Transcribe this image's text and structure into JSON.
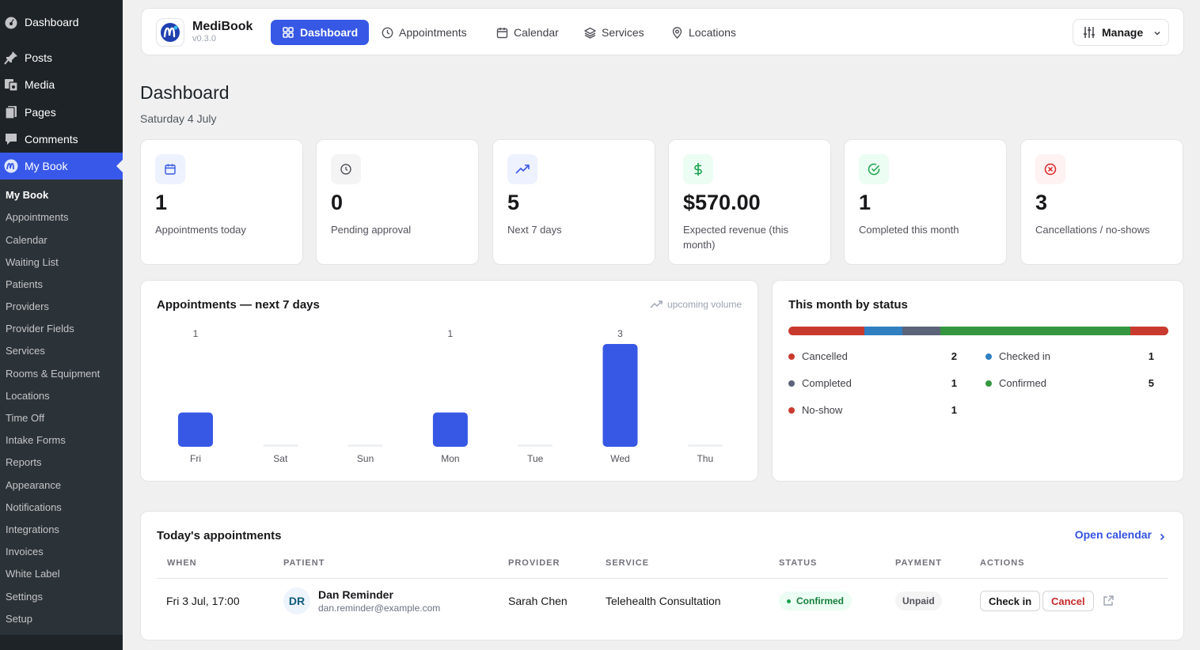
{
  "wp_menu": {
    "top_items": [
      {
        "label": "Dashboard",
        "icon": "dashboard-icon"
      },
      {
        "label": "Posts",
        "icon": "pin-icon"
      },
      {
        "label": "Media",
        "icon": "media-icon"
      },
      {
        "label": "Pages",
        "icon": "pages-icon"
      },
      {
        "label": "Comments",
        "icon": "comment-icon"
      },
      {
        "label": "My Book",
        "icon": "medibook-logo-icon"
      }
    ],
    "submenu": [
      "My Book",
      "Appointments",
      "Calendar",
      "Waiting List",
      "Patients",
      "Providers",
      "Provider Fields",
      "Services",
      "Rooms & Equipment",
      "Locations",
      "Time Off",
      "Intake Forms",
      "Reports",
      "Appearance",
      "Notifications",
      "Integrations",
      "Invoices",
      "White Label",
      "Settings",
      "Setup"
    ]
  },
  "brand": {
    "name": "MediBook",
    "version": "v0.3.0"
  },
  "nav": {
    "tabs": [
      {
        "label": "Dashboard",
        "icon": "grid-icon"
      },
      {
        "label": "Appointments",
        "icon": "clock-icon"
      },
      {
        "label": "Calendar",
        "icon": "calendar-icon"
      },
      {
        "label": "Services",
        "icon": "layers-icon"
      },
      {
        "label": "Locations",
        "icon": "map-pin-icon"
      }
    ],
    "manage_label": "Manage"
  },
  "page": {
    "title": "Dashboard",
    "date": "Saturday 4 July"
  },
  "stats": [
    {
      "value": "1",
      "label": "Appointments today",
      "icon": "calendar-icon",
      "color": "#3758e5",
      "bg": "#eef2ff"
    },
    {
      "value": "0",
      "label": "Pending approval",
      "icon": "clock-icon",
      "color": "#52525b",
      "bg": "#f4f4f5"
    },
    {
      "value": "5",
      "label": "Next 7 days",
      "icon": "trending-up-icon",
      "color": "#3758e5",
      "bg": "#eef2ff"
    },
    {
      "value": "$570.00",
      "label": "Expected revenue (this month)",
      "icon": "dollar-icon",
      "color": "#16a34a",
      "bg": "#ecfdf3"
    },
    {
      "value": "1",
      "label": "Completed this month",
      "icon": "check-circle-icon",
      "color": "#16a34a",
      "bg": "#ecfdf3"
    },
    {
      "value": "3",
      "label": "Cancellations / no-shows",
      "icon": "x-circle-icon",
      "color": "#dc2626",
      "bg": "#fef2f2"
    }
  ],
  "chart_data": {
    "type": "bar",
    "title": "Appointments — next 7 days",
    "subtitle": "upcoming volume",
    "categories": [
      "Fri",
      "Sat",
      "Sun",
      "Mon",
      "Tue",
      "Wed",
      "Thu"
    ],
    "values": [
      1,
      0,
      0,
      1,
      0,
      3,
      0
    ],
    "ylim": [
      0,
      3
    ],
    "bar_color": "#3758e5",
    "grid": false
  },
  "status_panel": {
    "title": "This month by status",
    "segments": [
      {
        "name": "Cancelled",
        "count": 2,
        "color": "#c93a2e"
      },
      {
        "name": "Checked in",
        "count": 1,
        "color": "#2f7fc1"
      },
      {
        "name": "Completed",
        "count": 1,
        "color": "#5b6478"
      },
      {
        "name": "Confirmed",
        "count": 5,
        "color": "#34963f"
      },
      {
        "name": "No-show",
        "count": 1,
        "color": "#c93a2e"
      }
    ],
    "legend": [
      {
        "name": "Cancelled",
        "count": "2",
        "color": "#c93a2e"
      },
      {
        "name": "Checked in",
        "count": "1",
        "color": "#2f7fc1"
      },
      {
        "name": "Completed",
        "count": "1",
        "color": "#5b6478"
      },
      {
        "name": "Confirmed",
        "count": "5",
        "color": "#34963f"
      },
      {
        "name": "No-show",
        "count": "1",
        "color": "#c93a2e"
      }
    ]
  },
  "today": {
    "title": "Today's appointments",
    "open_calendar": "Open calendar",
    "columns": [
      "WHEN",
      "PATIENT",
      "PROVIDER",
      "SERVICE",
      "STATUS",
      "PAYMENT",
      "ACTIONS"
    ],
    "rows": [
      {
        "when": "Fri 3 Jul, 17:00",
        "initials": "DR",
        "patient_name": "Dan Reminder",
        "patient_email": "dan.reminder@example.com",
        "provider": "Sarah Chen",
        "service": "Telehealth Consultation",
        "status": "Confirmed",
        "payment": "Unpaid",
        "check_in": "Check in",
        "cancel": "Cancel"
      }
    ]
  }
}
